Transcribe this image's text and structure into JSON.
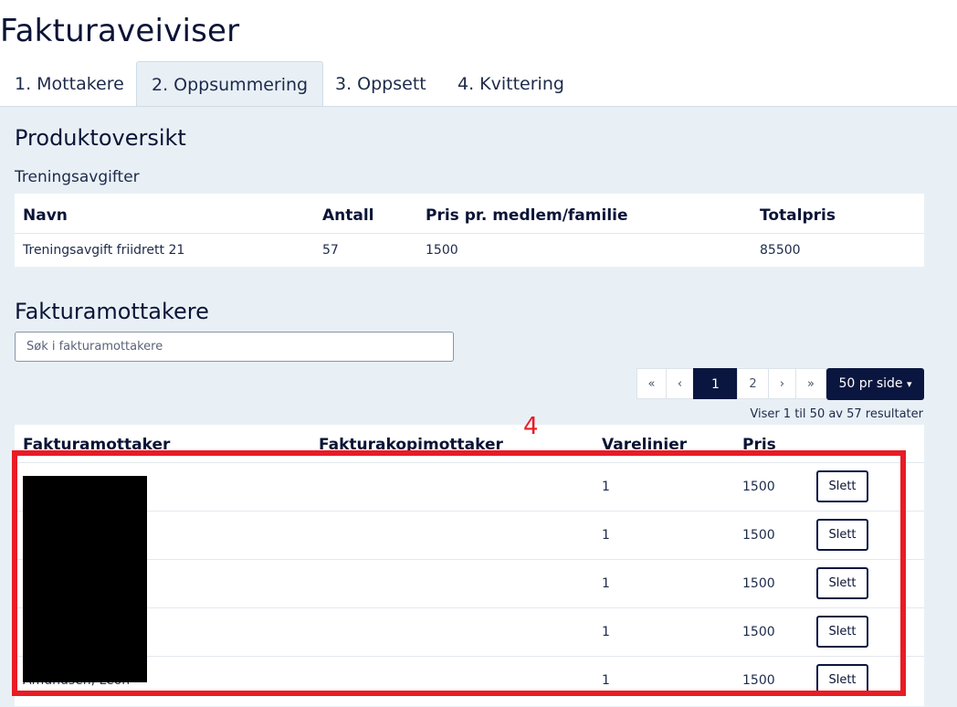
{
  "page": {
    "title": "Fakturaveiviser"
  },
  "tabs": [
    {
      "label": "1. Mottakere",
      "active": false
    },
    {
      "label": "2. Oppsummering",
      "active": true
    },
    {
      "label": "3. Oppsett",
      "active": false
    },
    {
      "label": "4. Kvittering",
      "active": false
    }
  ],
  "products": {
    "heading": "Produktoversikt",
    "group_label": "Treningsavgifter",
    "columns": [
      "Navn",
      "Antall",
      "Pris pr. medlem/familie",
      "Totalpris"
    ],
    "rows": [
      [
        "Treningsavgift friidrett 21",
        "57",
        "1500",
        "85500"
      ]
    ]
  },
  "recipients": {
    "heading": "Fakturamottakere",
    "search_placeholder": "Søk i fakturamottakere",
    "pagination": {
      "first": "«",
      "prev": "‹",
      "pages": [
        "1",
        "2"
      ],
      "current_page": "1",
      "next": "›",
      "last": "»",
      "per_page_label": "50 pr side",
      "per_page_caret": "▾"
    },
    "result_text": "Viser 1 til 50 av 57 resultater",
    "columns": [
      "Fakturamottaker",
      "Fakturakopimottaker",
      "Varelinier",
      "Pris"
    ],
    "delete_label": "Slett",
    "rows": [
      {
        "name": "",
        "copy": "",
        "lines": "1",
        "price": "1500"
      },
      {
        "name": "",
        "copy": "",
        "lines": "1",
        "price": "1500"
      },
      {
        "name": "",
        "copy": "",
        "lines": "1",
        "price": "1500"
      },
      {
        "name": "",
        "copy": "",
        "lines": "1",
        "price": "1500"
      },
      {
        "name": "Amundsen, Leon",
        "copy": "",
        "lines": "1",
        "price": "1500"
      }
    ]
  },
  "annotation": {
    "label": "4",
    "color": "#e81c25"
  },
  "colors": {
    "navy": "#0b1640",
    "panel_bg": "#e8f0f6",
    "annotation_red": "#e81c25"
  }
}
